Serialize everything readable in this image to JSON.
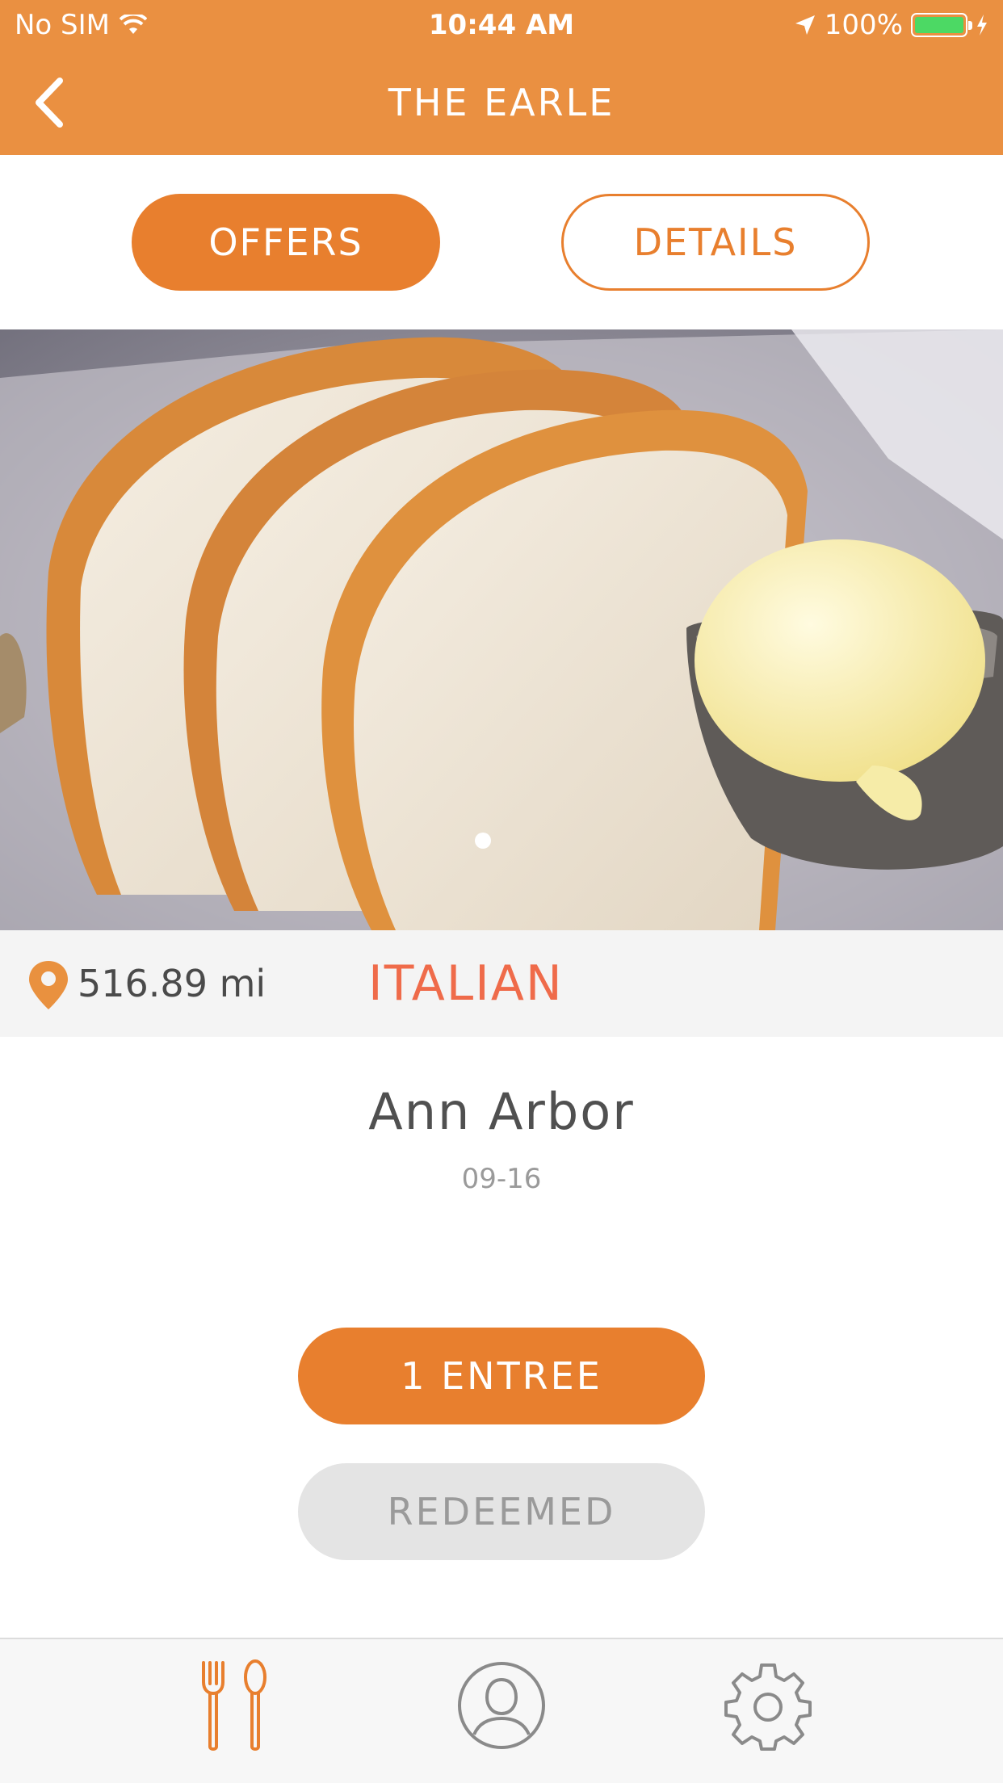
{
  "status_bar": {
    "carrier": "No SIM",
    "time": "10:44 AM",
    "battery": "100%"
  },
  "nav": {
    "title": "THE EARLE"
  },
  "segments": {
    "offers": "OFFERS",
    "details": "DETAILS"
  },
  "info": {
    "distance": "516.89 mi",
    "cuisine": "ITALIAN"
  },
  "offer": {
    "city": "Ann Arbor",
    "date": "09-16",
    "primary_button": "1 ENTREE",
    "status_button": "REDEEMED"
  },
  "tabbar": {
    "items": [
      {
        "icon": "fork-spoon-icon",
        "active": true
      },
      {
        "icon": "profile-icon",
        "active": false
      },
      {
        "icon": "gear-icon",
        "active": false
      }
    ]
  },
  "colors": {
    "brand_orange": "#e87f2e",
    "header_orange": "#ea9041",
    "cuisine_red": "#ef6b4a",
    "battery_green": "#4cd964"
  }
}
